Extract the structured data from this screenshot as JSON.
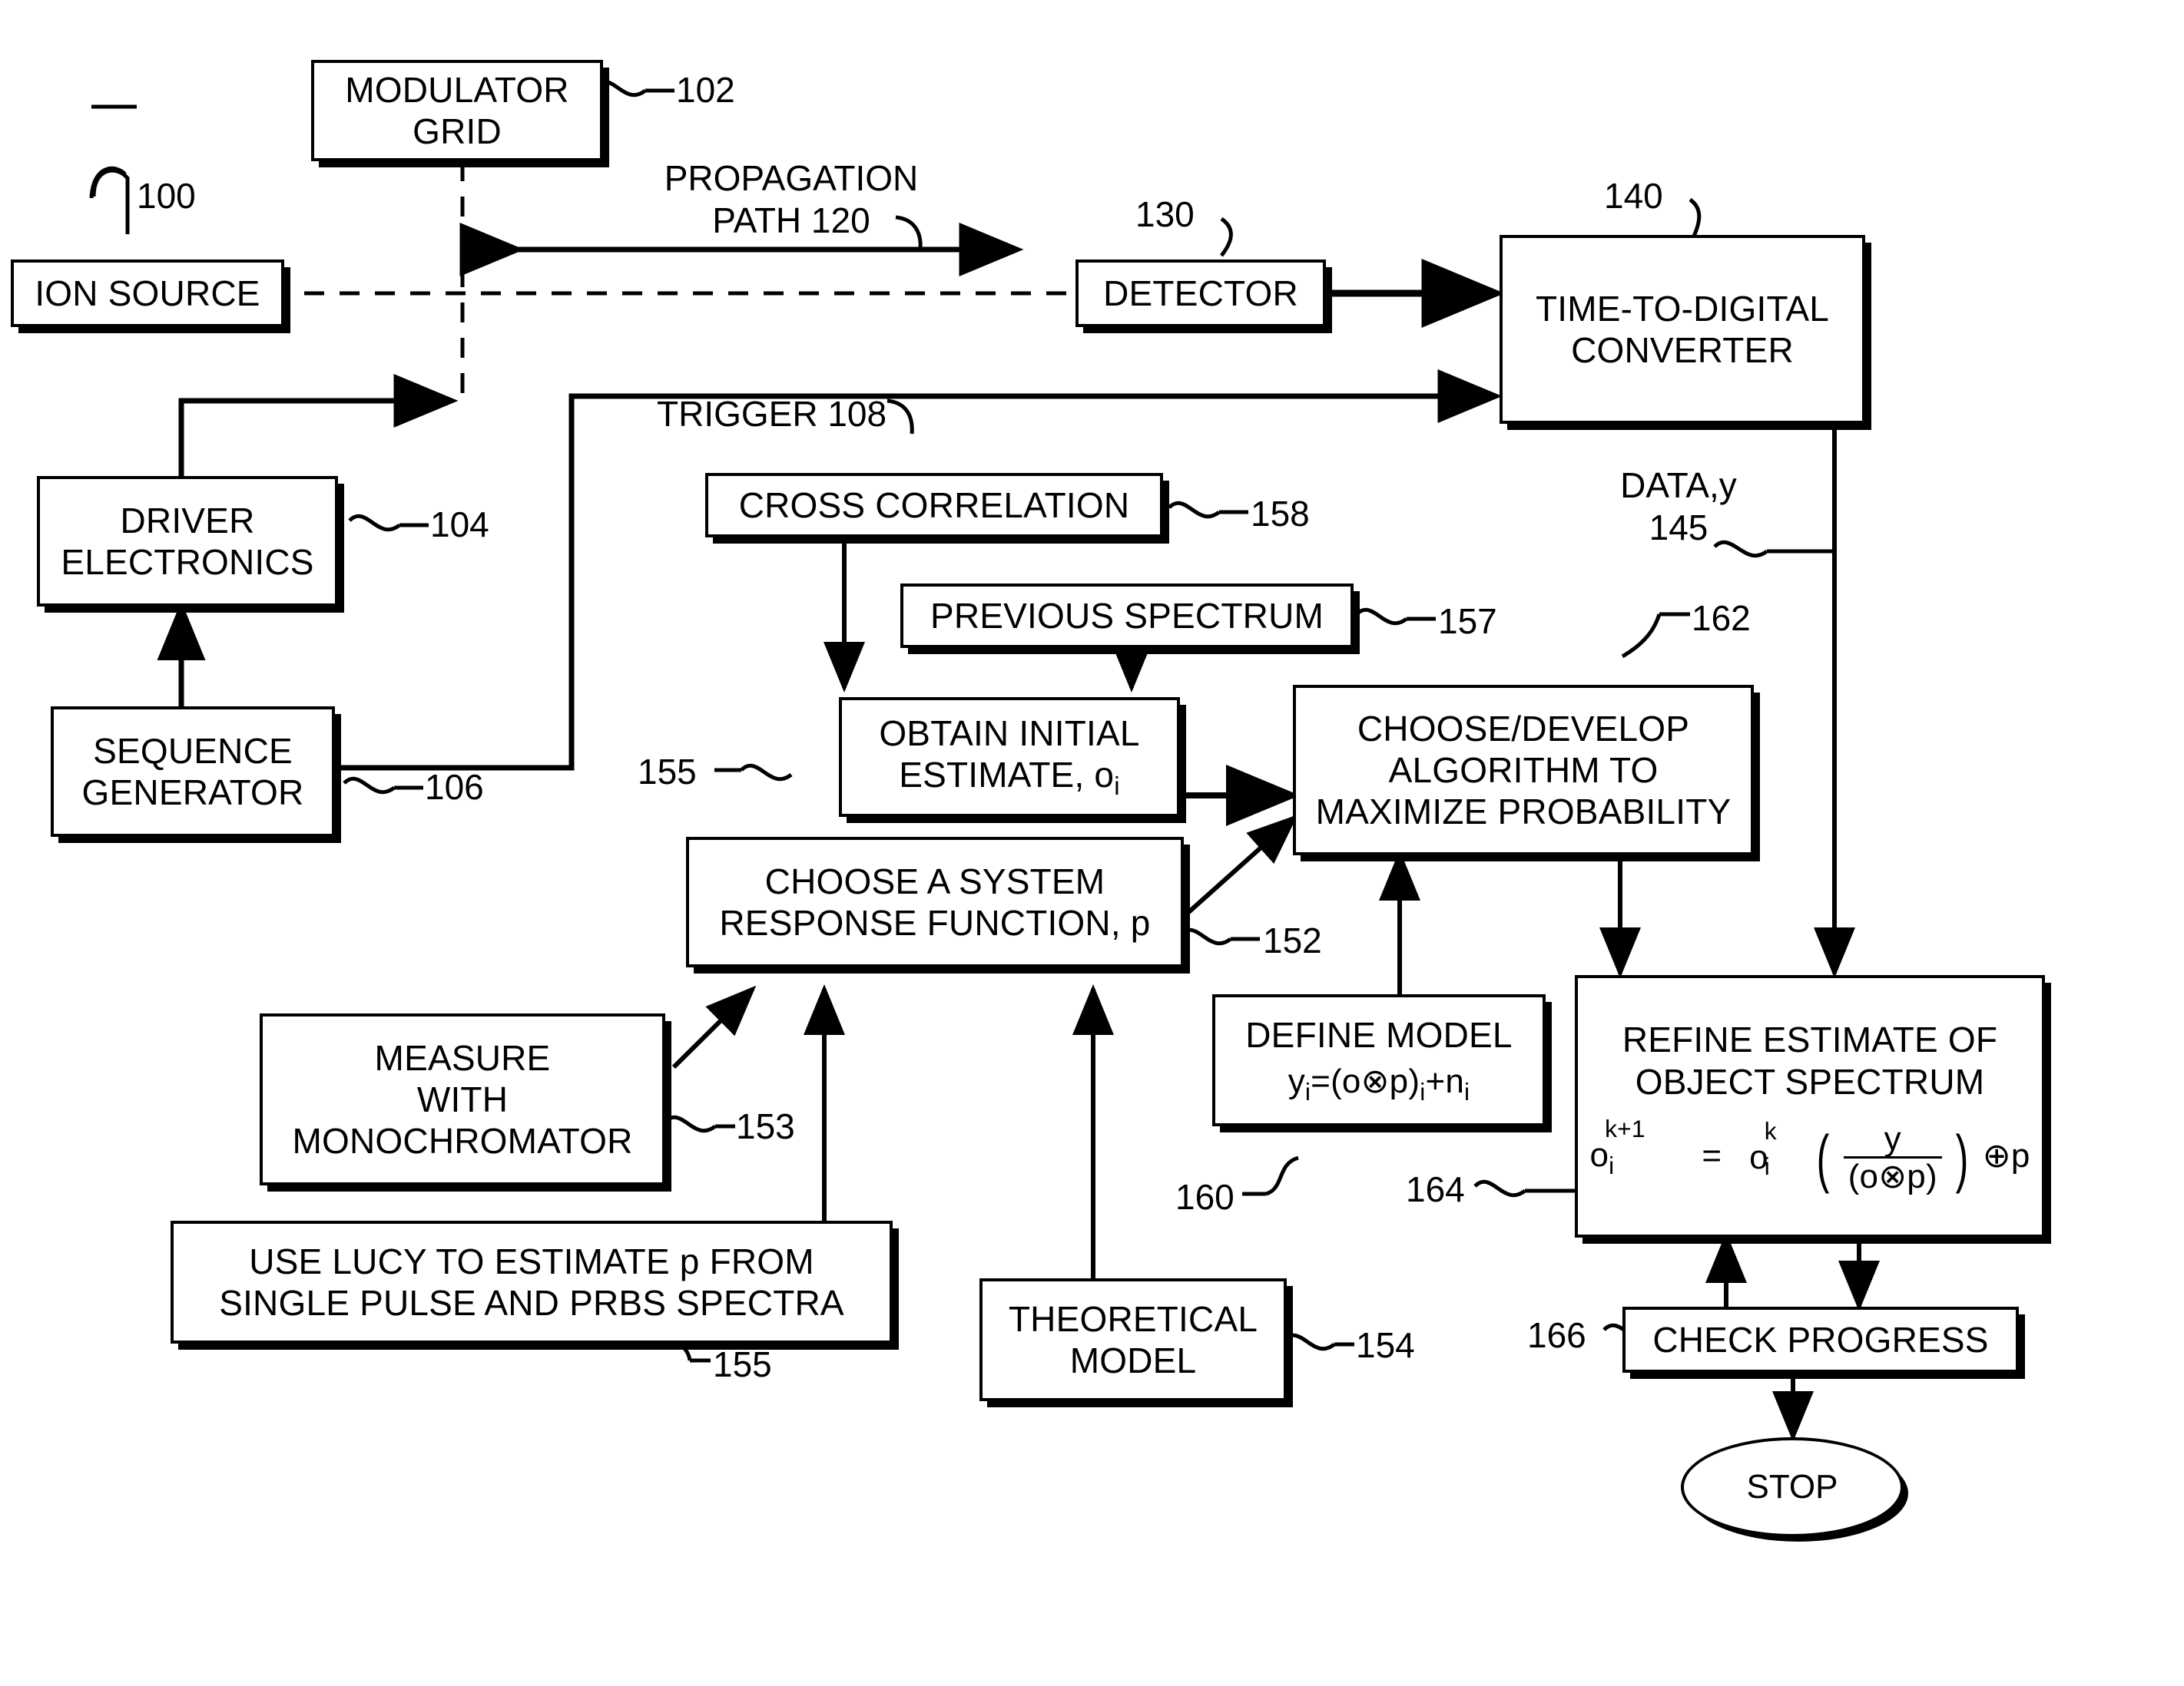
{
  "figure": {
    "type": "patent-flow-diagram",
    "title": "Ion mobility / mass-spectrometry modulation and Lucy deconvolution flow diagram"
  },
  "blocks": [
    {
      "id": "modulator-grid",
      "label": "MODULATOR\nGRID",
      "ref": "102"
    },
    {
      "id": "ion-source",
      "label": "ION SOURCE",
      "ref": "100"
    },
    {
      "id": "detector",
      "label": "DETECTOR",
      "ref": "130"
    },
    {
      "id": "tdc",
      "label": "TIME-TO-DIGITAL\nCONVERTER",
      "ref": "140"
    },
    {
      "id": "driver-electronics",
      "label": "DRIVER\nELECTRONICS",
      "ref": "104"
    },
    {
      "id": "sequence-generator",
      "label": "SEQUENCE\nGENERATOR",
      "ref": "106"
    },
    {
      "id": "cross-correlation",
      "label": "CROSS CORRELATION",
      "ref": "158"
    },
    {
      "id": "previous-spectrum",
      "label": "PREVIOUS SPECTRUM",
      "ref": "157"
    },
    {
      "id": "obtain-estimate",
      "label": "OBTAIN INITIAL\nESTIMATE, o",
      "ref": "155"
    },
    {
      "id": "choose-algorithm",
      "label": "CHOOSE/DEVELOP\nALGORITHM TO\nMAXIMIZE PROBABILITY",
      "ref": "162"
    },
    {
      "id": "choose-response",
      "label": "CHOOSE A SYSTEM\nRESPONSE FUNCTION, p",
      "ref": "152"
    },
    {
      "id": "measure-mono",
      "label": "MEASURE\nWITH\nMONOCHROMATOR",
      "ref": "153"
    },
    {
      "id": "use-lucy",
      "label": "USE LUCY TO ESTIMATE p FROM\nSINGLE PULSE AND PRBS SPECTRA",
      "ref": "155"
    },
    {
      "id": "theoretical-model",
      "label": "THEORETICAL\nMODEL",
      "ref": "154"
    },
    {
      "id": "define-model",
      "label": "DEFINE MODEL",
      "ref": "160"
    },
    {
      "id": "refine-estimate",
      "label": "REFINE ESTIMATE OF\nOBJECT SPECTRUM",
      "ref": "164"
    },
    {
      "id": "check-progress",
      "label": "CHECK PROGRESS",
      "ref": "166"
    },
    {
      "id": "stop",
      "label": "STOP",
      "ref": ""
    }
  ],
  "texts": {
    "modulator_grid": "MODULATOR",
    "modulator_grid2": "GRID",
    "ion_source": "ION SOURCE",
    "detector": "DETECTOR",
    "tdc_line1": "TIME-TO-DIGITAL",
    "tdc_line2": "CONVERTER",
    "driver_line1": "DRIVER",
    "driver_line2": "ELECTRONICS",
    "seqgen_line1": "SEQUENCE",
    "seqgen_line2": "GENERATOR",
    "cross_correlation": "CROSS CORRELATION",
    "previous_spectrum": "PREVIOUS SPECTRUM",
    "obtain_line1": "OBTAIN INITIAL",
    "obtain_line2": "ESTIMATE, o",
    "obtain_sub": "i",
    "algo_line1": "CHOOSE/DEVELOP",
    "algo_line2": "ALGORITHM TO",
    "algo_line3": "MAXIMIZE PROBABILITY",
    "resp_line1": "CHOOSE A SYSTEM",
    "resp_line2": "RESPONSE FUNCTION, p",
    "measure_line1": "MEASURE",
    "measure_line2": "WITH",
    "measure_line3": "MONOCHROMATOR",
    "lucy_line1": "USE LUCY TO ESTIMATE p FROM",
    "lucy_line2": "SINGLE PULSE AND PRBS SPECTRA",
    "theory_line1": "THEORETICAL",
    "theory_line2": "MODEL",
    "define_model_title": "DEFINE MODEL",
    "refine_line1": "REFINE ESTIMATE OF",
    "refine_line2": "OBJECT SPECTRUM",
    "check_progress": "CHECK PROGRESS",
    "stop": "STOP",
    "propagation_line1": "PROPAGATION",
    "propagation_line2": "PATH 120",
    "trigger": "TRIGGER 108",
    "data_line1": "DATA,y",
    "data_line2": "145"
  },
  "equations": {
    "define_model": {
      "full": "yi=(o⊗p)i+ni",
      "lhs_base": "y",
      "lhs_sub": "i",
      "eq": "=(o",
      "otimes": "⊗",
      "p_close": "p)",
      "mid_sub": "i",
      "plus_n": "+n",
      "n_sub": "i"
    },
    "refine": {
      "full": "oi^(k+1) = oi^k ( y / (o⊗p) ) ⊕ p",
      "o1": "o",
      "o1_sub": "i",
      "o1_sup": "k+1",
      "equals": "=",
      "o2": "o",
      "o2_sub": "i",
      "o2_sup": "k",
      "numerator": "y",
      "denominator": "(o⊗p)",
      "oplus": "⊕",
      "p": "p"
    }
  },
  "reference_numerals": {
    "n100": "100",
    "n102": "102",
    "n104": "104",
    "n106": "106",
    "n130": "130",
    "n140": "140",
    "n145": "145",
    "n152": "152",
    "n153": "153",
    "n154": "154",
    "n155a": "155",
    "n155b": "155",
    "n157": "157",
    "n158": "158",
    "n160": "160",
    "n162": "162",
    "n164": "164",
    "n166": "166"
  },
  "colors": {
    "ink": "#000000",
    "paper": "#ffffff"
  }
}
